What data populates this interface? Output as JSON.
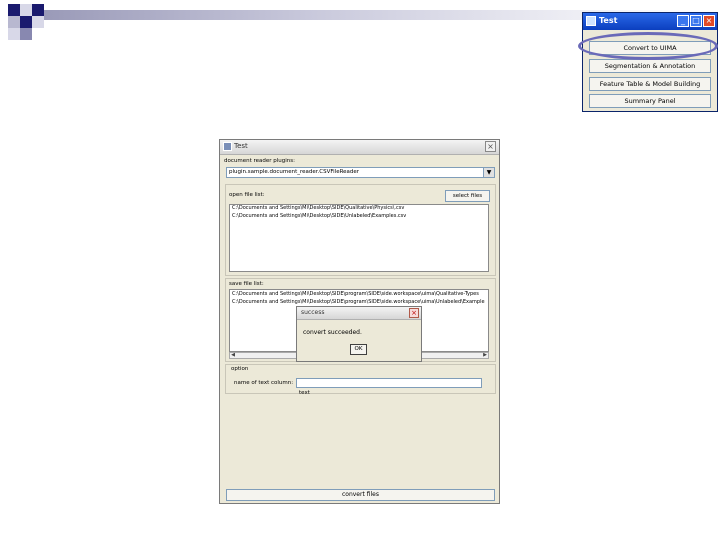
{
  "launcher": {
    "title": "Test",
    "buttons": [
      "Convert to UIMA",
      "Segmentation & Annotation",
      "Feature Table & Model Building",
      "Summary Panel"
    ]
  },
  "window": {
    "title": "Test",
    "reader_label": "document reader plugins:",
    "reader_value": "plugin.sample.document_reader.CSVFileReader",
    "open_label": "open file list:",
    "select_files": "select files",
    "open_files": [
      "C:\\Documents and Settings\\Mi\\Desktop\\SIDE\\Qualitative\\Physics\\.csv",
      "C:\\Documents and Settings\\Mi\\Desktop\\SIDE\\Unlabeled\\Examples.csv"
    ],
    "save_label": "save file list:",
    "save_files": [
      "C:\\Documents and Settings\\Mi\\Desktop\\SIDE\\program\\SIDE\\side.workspace\\uima\\Qualitative-Types",
      "C:\\Documents and Settings\\Mi\\Desktop\\SIDE\\program\\SIDE\\side.workspace\\uima\\Unlabeled\\Example"
    ],
    "option_label": "option",
    "text_column_label": "name of text column:",
    "text_column_value": "text",
    "convert_button": "convert files"
  },
  "dialog": {
    "title": "success",
    "message": "convert succeeded.",
    "ok": "OK"
  },
  "colors": {
    "deco_dark": "#1a1a6e",
    "deco_mid": "#8888b0",
    "deco_light": "#c8c8dc",
    "highlight": "#6a6ab8",
    "launcher_titlebar": "#0b3fbf"
  }
}
